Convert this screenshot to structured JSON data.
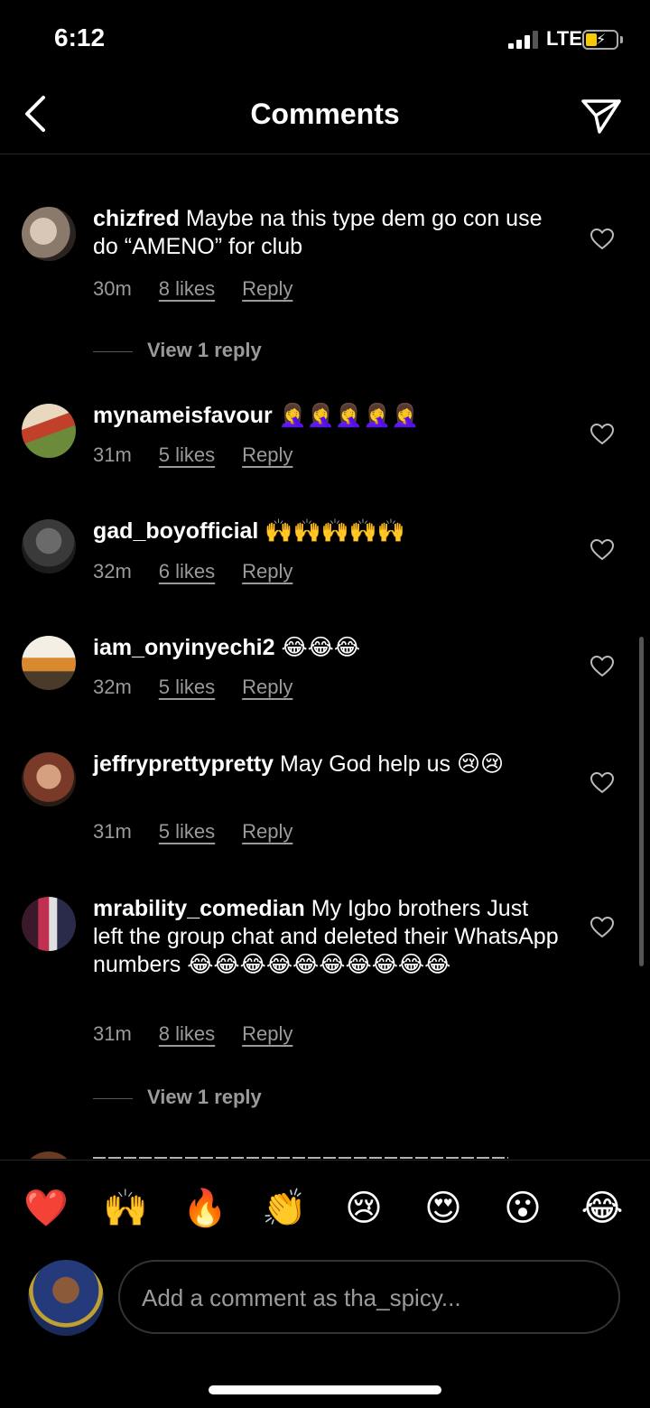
{
  "status_bar": {
    "time": "6:12",
    "network": "LTE"
  },
  "header": {
    "title": "Comments"
  },
  "comments": [
    {
      "username": "chizfred",
      "text": "Maybe na this type dem go con use do “AMENO” for club",
      "time": "30m",
      "likes": "8 likes",
      "reply": "Reply",
      "view_replies": "View 1 reply"
    },
    {
      "username": "mynameisfavour",
      "text": "🤦‍♀️🤦‍♀️🤦‍♀️🤦‍♀️🤦‍♀️",
      "time": "31m",
      "likes": "5 likes",
      "reply": "Reply"
    },
    {
      "username": "gad_boyofficial",
      "text": "🙌🙌🙌🙌🙌",
      "time": "32m",
      "likes": "6 likes",
      "reply": "Reply"
    },
    {
      "username": "iam_onyinyechi2",
      "text": "😂😂😂",
      "time": "32m",
      "likes": "5 likes",
      "reply": "Reply"
    },
    {
      "username": "jeffryprettypretty",
      "text": "May God help us 😢😢",
      "time": "31m",
      "likes": "5 likes",
      "reply": "Reply"
    },
    {
      "username": "mrability_comedian",
      "text": "My Igbo brothers Just left the group chat and deleted their WhatsApp numbers 😂😂😂😂😂😂😂😂😂😂",
      "time": "31m",
      "likes": "8 likes",
      "reply": "Reply",
      "view_replies": "View 1 reply"
    }
  ],
  "quick_emojis": [
    "❤️",
    "🙌",
    "🔥",
    "👏",
    "😢",
    "😍",
    "😮",
    "😂"
  ],
  "composer": {
    "placeholder": "Add a comment as tha_spicy..."
  }
}
